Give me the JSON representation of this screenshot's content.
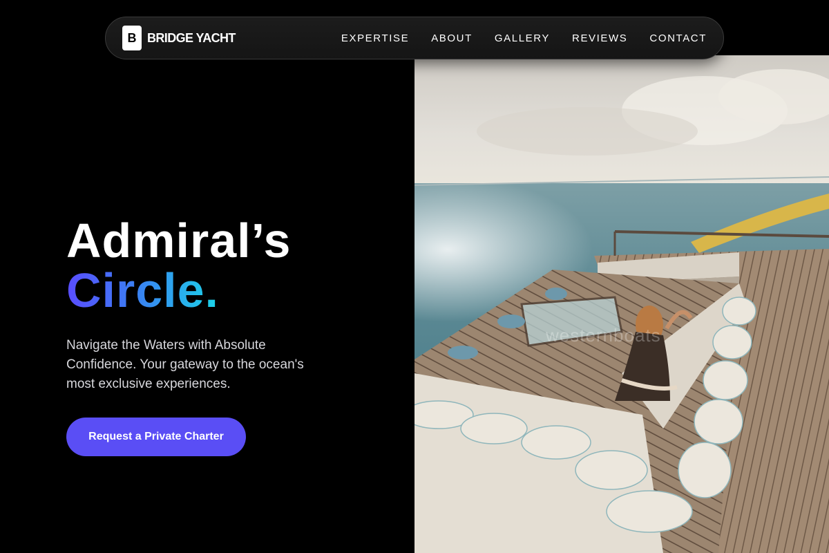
{
  "brand": {
    "logo_letter": "B",
    "name": "BRIDGE YACHT"
  },
  "nav": {
    "links": [
      {
        "label": "EXPERTISE"
      },
      {
        "label": "ABOUT"
      },
      {
        "label": "GALLERY"
      },
      {
        "label": "REVIEWS"
      },
      {
        "label": "CONTACT"
      }
    ]
  },
  "hero": {
    "headline_line1": "Admiral’s",
    "headline_line2": "Circle.",
    "subtitle": "Navigate the Waters with Absolute Confidence. Your gateway to the ocean's most exclusive experiences.",
    "cta_label": "Request a Private Charter",
    "image_watermark": "westernboats"
  },
  "colors": {
    "background": "#000000",
    "accent": "#5a4ef5",
    "gradient_start": "#5a4dff",
    "gradient_end": "#1bd4e8"
  },
  "icons": {
    "brand_logo": "letter-b-square"
  }
}
